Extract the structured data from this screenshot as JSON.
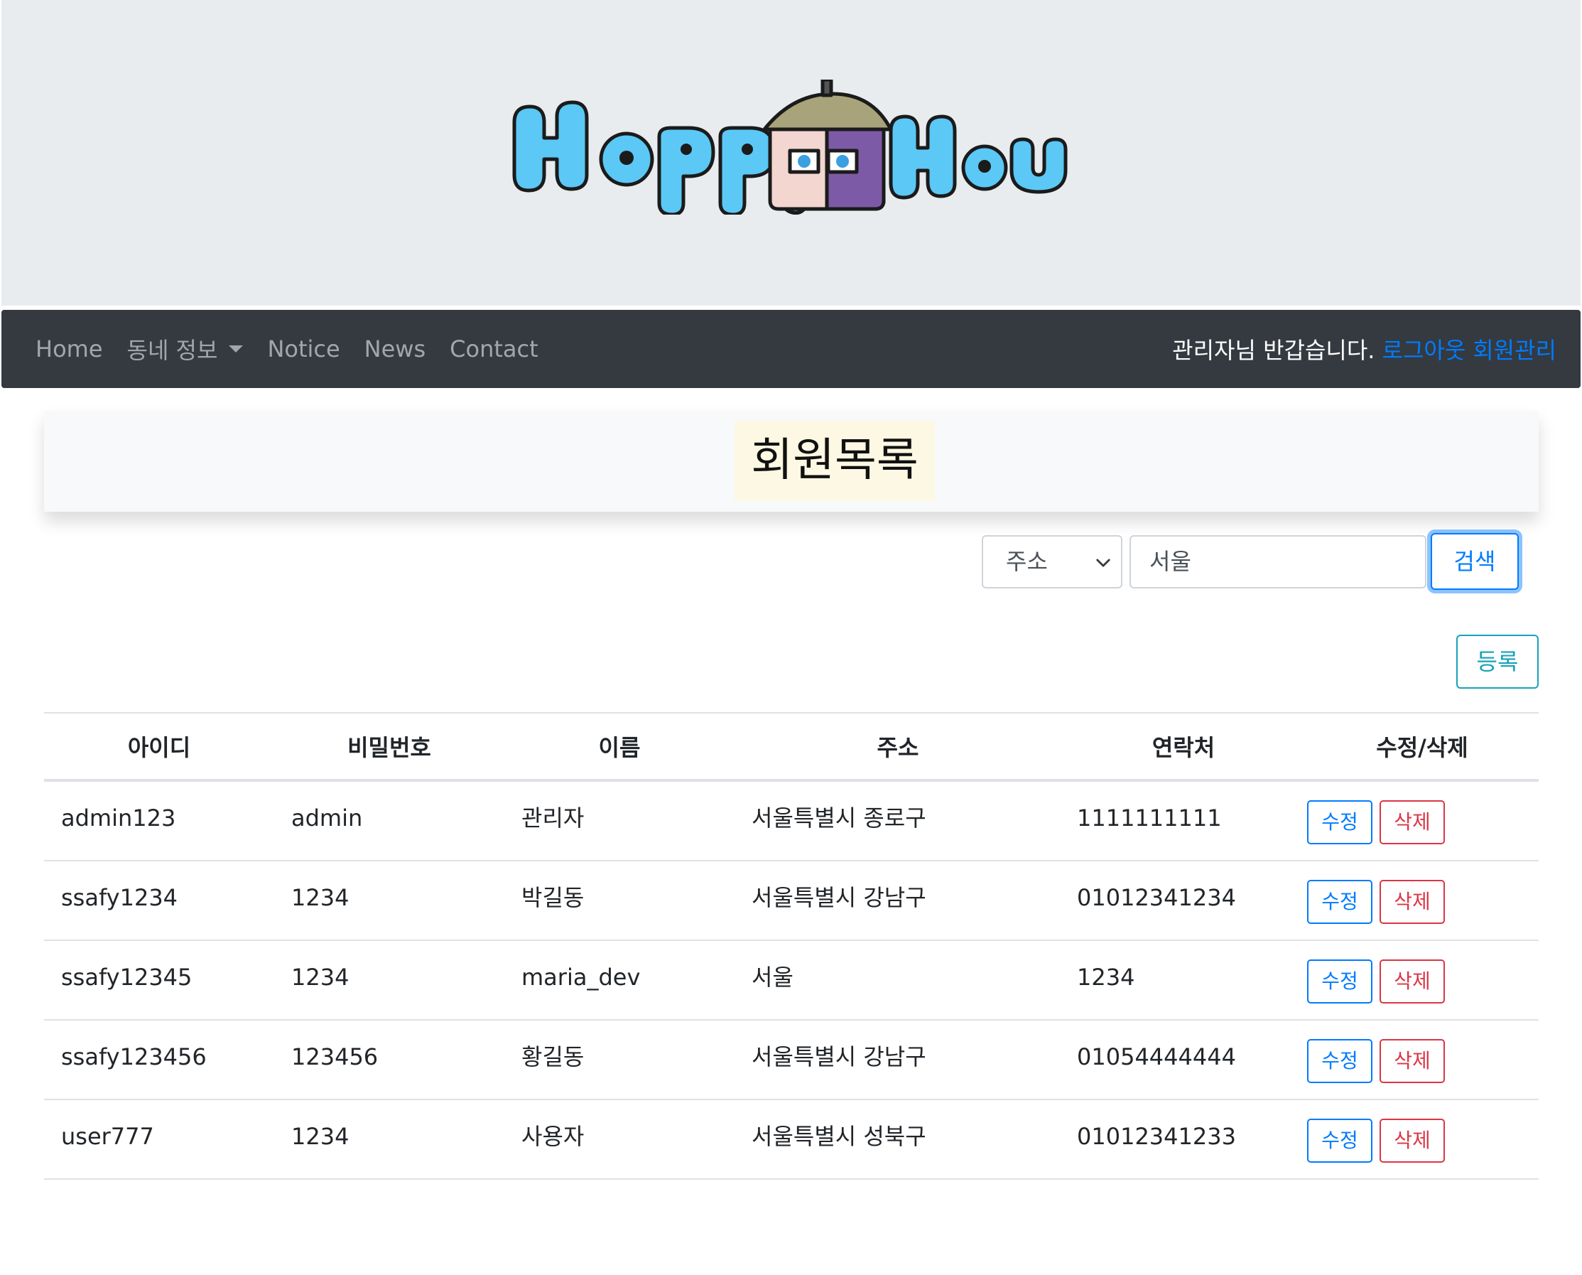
{
  "logo": {
    "text": "HappyHouse"
  },
  "navbar": {
    "links": [
      {
        "label": "Home"
      },
      {
        "label": "동네 정보",
        "dropdown": true
      },
      {
        "label": "Notice"
      },
      {
        "label": "News"
      },
      {
        "label": "Contact"
      }
    ],
    "greeting": "관리자님 반갑습니다.",
    "logout_label": "로그아웃",
    "member_admin_label": "회원관리"
  },
  "page": {
    "title": "회원목록"
  },
  "search": {
    "field_selected": "주소",
    "query_value": "서울",
    "button_label": "검색"
  },
  "register_label": "등록",
  "table": {
    "headers": {
      "id": "아이디",
      "password": "비밀번호",
      "name": "이름",
      "address": "주소",
      "phone": "연락처",
      "actions": "수정/삭제"
    },
    "edit_label": "수정",
    "delete_label": "삭제",
    "rows": [
      {
        "id": "admin123",
        "password": "admin",
        "name": "관리자",
        "address": "서울특별시 종로구",
        "phone": "1111111111"
      },
      {
        "id": "ssafy1234",
        "password": "1234",
        "name": "박길동",
        "address": "서울특별시 강남구",
        "phone": "01012341234"
      },
      {
        "id": "ssafy12345",
        "password": "1234",
        "name": "maria_dev",
        "address": "서울",
        "phone": "1234"
      },
      {
        "id": "ssafy123456",
        "password": "123456",
        "name": "황길동",
        "address": "서울특별시 강남구",
        "phone": "01054444444"
      },
      {
        "id": "user777",
        "password": "1234",
        "name": "사용자",
        "address": "서울특별시 성북구",
        "phone": "01012341233"
      }
    ]
  },
  "colors": {
    "navbar_bg": "#343a40",
    "link_primary": "#007bff",
    "danger": "#dc3545",
    "info": "#17a2b8",
    "logo_blue": "#5bc8f5"
  }
}
